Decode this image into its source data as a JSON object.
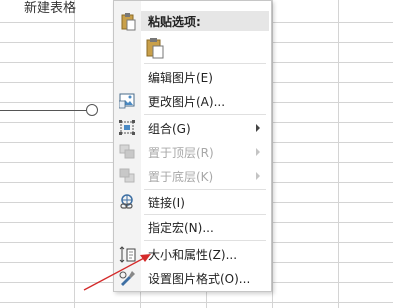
{
  "sheet": {
    "cell_text": "新建表格"
  },
  "context_menu": {
    "paste_header": "粘贴选项:",
    "items": [
      {
        "label": "编辑图片(E)",
        "icon": "none",
        "enabled": true,
        "submenu": false
      },
      {
        "label": "更改图片(A)...",
        "icon": "change-picture-icon",
        "enabled": true,
        "submenu": false
      },
      {
        "label": "组合(G)",
        "icon": "group-icon",
        "enabled": true,
        "submenu": true
      },
      {
        "label": "置于顶层(R)",
        "icon": "bring-to-front-icon",
        "enabled": false,
        "submenu": true
      },
      {
        "label": "置于底层(K)",
        "icon": "send-to-back-icon",
        "enabled": false,
        "submenu": true
      },
      {
        "label": "链接(I)",
        "icon": "link-icon",
        "enabled": true,
        "submenu": false
      },
      {
        "label": "指定宏(N)...",
        "icon": "none",
        "enabled": true,
        "submenu": false
      },
      {
        "label": "大小和属性(Z)...",
        "icon": "size-properties-icon",
        "enabled": true,
        "submenu": false
      },
      {
        "label": "设置图片格式(O)...",
        "icon": "format-picture-icon",
        "enabled": true,
        "submenu": false
      }
    ]
  },
  "colors": {
    "annotation_arrow": "#d42a2a",
    "disabled_text": "#a8a8a8"
  }
}
